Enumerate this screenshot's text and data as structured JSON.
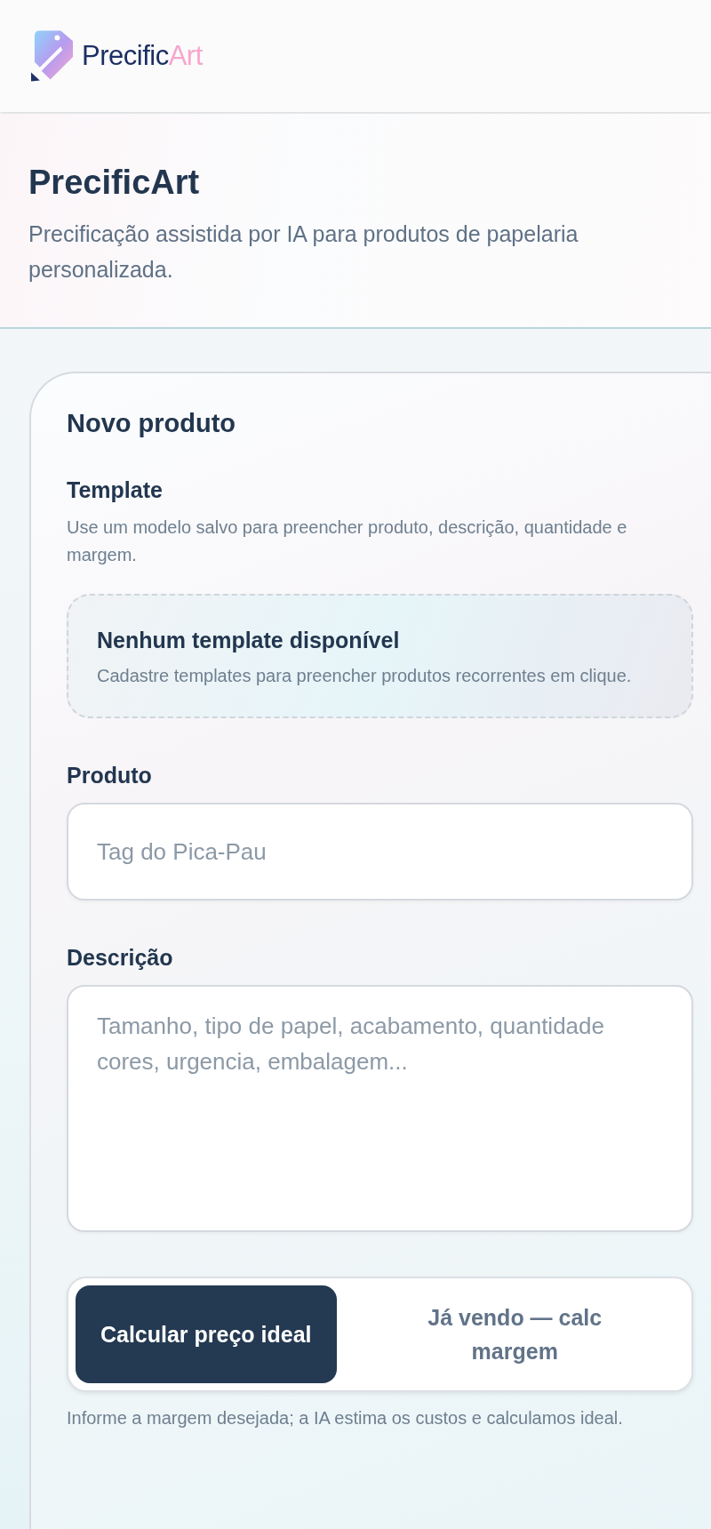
{
  "brand": {
    "name": "Precific",
    "accent": "Art"
  },
  "hero": {
    "title": "PrecificArt",
    "subtitle": "Precificação assistida por IA para produtos de papelaria personalizada."
  },
  "card": {
    "title": "Novo produto",
    "template": {
      "label": "Template",
      "help": "Use um modelo salvo para preencher produto, descrição, quantidade e margem.",
      "empty_title": "Nenhum template disponível",
      "empty_text": "Cadastre templates para preencher produtos recorrentes em clique."
    },
    "fields": [
      {
        "kind": "input",
        "label": "Produto",
        "placeholder": "Tag do Pica-Pau"
      },
      {
        "kind": "textarea",
        "label": "Descrição",
        "placeholder": "Tamanho, tipo de papel, acabamento, quantidade cores, urgencia, embalagem..."
      }
    ],
    "modes": [
      {
        "label": "Calcular preço ideal",
        "selected": true
      },
      {
        "label": "Já vendo — calc margem",
        "selected": false
      }
    ],
    "hint": "Informe a margem desejada; a IA estima os custos e calculamos ideal."
  }
}
